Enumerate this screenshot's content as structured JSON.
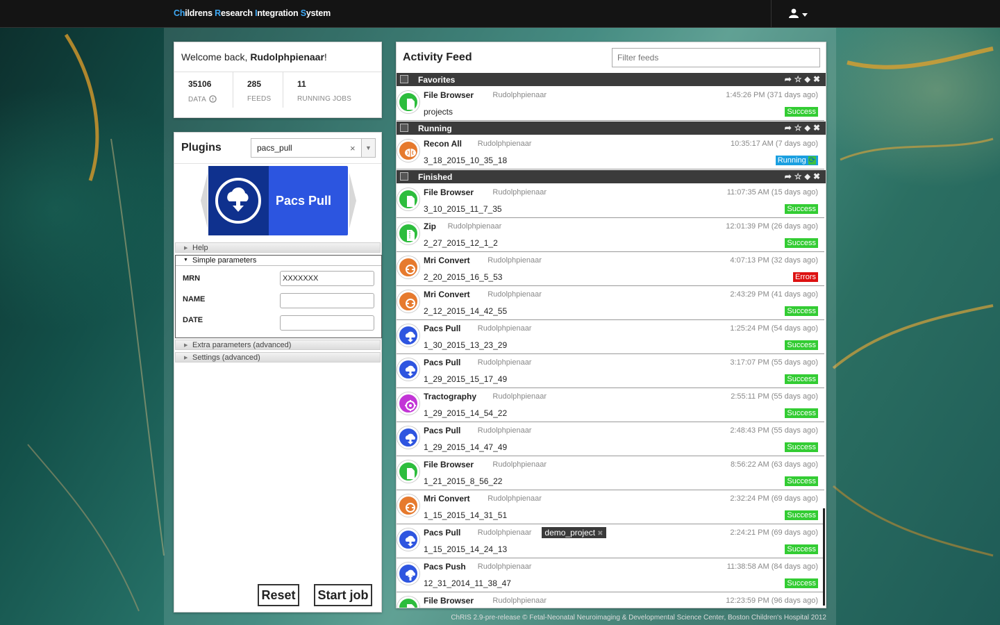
{
  "navbar": {
    "brand_parts": [
      "Ch",
      "ildrens ",
      "R",
      "esearch ",
      "I",
      "ntegration ",
      "S",
      "ystem"
    ]
  },
  "welcome": {
    "prefix": "Welcome back, ",
    "user": "Rudolphpienaar",
    "suffix": "!",
    "stats": [
      {
        "num": "35106",
        "label": "DATA"
      },
      {
        "num": "285",
        "label": "FEEDS"
      },
      {
        "num": "11",
        "label": "RUNNING JOBS"
      }
    ]
  },
  "plugins": {
    "title": "Plugins",
    "select_value": "pacs_pull",
    "clear": "×",
    "tile_name": "Pacs Pull",
    "sections": {
      "help": "Help",
      "simple": "Simple parameters",
      "extra": "Extra parameters (advanced)",
      "settings": "Settings (advanced)"
    },
    "params": [
      {
        "label": "MRN",
        "value": "XXXXXXX"
      },
      {
        "label": "NAME",
        "value": ""
      },
      {
        "label": "DATE",
        "value": ""
      }
    ],
    "reset": "Reset",
    "start": "Start job"
  },
  "feed": {
    "title": "Activity Feed",
    "filter_placeholder": "Filter feeds",
    "groups": [
      {
        "label": "Favorites",
        "items": [
          {
            "plugin": "File Browser",
            "user": "Rudolphpienaar",
            "time": "1:45:26 PM (371 days ago)",
            "feed": "projects",
            "status": "Success",
            "icon": "file-icon"
          }
        ]
      },
      {
        "label": "Running",
        "items": [
          {
            "plugin": "Recon All",
            "user": "Rudolphpienaar",
            "time": "10:35:17 AM (7 days ago)",
            "feed": "3_18_2015_10_35_18",
            "status": "Running",
            "icon": "brain-icon"
          }
        ]
      },
      {
        "label": "Finished",
        "items": [
          {
            "plugin": "File Browser",
            "user": "Rudolphpienaar",
            "time": "11:07:35 AM (15 days ago)",
            "feed": "3_10_2015_11_7_35",
            "status": "Success",
            "icon": "file-icon"
          },
          {
            "plugin": "Zip",
            "user": "Rudolphpienaar",
            "time": "12:01:39 PM (26 days ago)",
            "feed": "2_27_2015_12_1_2",
            "status": "Success",
            "icon": "zip-icon"
          },
          {
            "plugin": "Mri Convert",
            "user": "Rudolphpienaar",
            "time": "4:07:13 PM (32 days ago)",
            "feed": "2_20_2015_16_5_53",
            "status": "Errors",
            "icon": "convert-icon"
          },
          {
            "plugin": "Mri Convert",
            "user": "Rudolphpienaar",
            "time": "2:43:29 PM (41 days ago)",
            "feed": "2_12_2015_14_42_55",
            "status": "Success",
            "icon": "convert-icon"
          },
          {
            "plugin": "Pacs Pull",
            "user": "Rudolphpienaar",
            "time": "1:25:24 PM (54 days ago)",
            "feed": "1_30_2015_13_23_29",
            "status": "Success",
            "icon": "cloud-download-icon"
          },
          {
            "plugin": "Pacs Pull",
            "user": "Rudolphpienaar",
            "time": "3:17:07 PM (55 days ago)",
            "feed": "1_29_2015_15_17_49",
            "status": "Success",
            "icon": "cloud-download-icon"
          },
          {
            "plugin": "Tractography",
            "user": "Rudolphpienaar",
            "time": "2:55:11 PM (55 days ago)",
            "feed": "1_29_2015_14_54_22",
            "status": "Success",
            "icon": "tractography-icon"
          },
          {
            "plugin": "Pacs Pull",
            "user": "Rudolphpienaar",
            "time": "2:48:43 PM (55 days ago)",
            "feed": "1_29_2015_14_47_49",
            "status": "Success",
            "icon": "cloud-download-icon"
          },
          {
            "plugin": "File Browser",
            "user": "Rudolphpienaar",
            "time": "8:56:22 AM (63 days ago)",
            "feed": "1_21_2015_8_56_22",
            "status": "Success",
            "icon": "file-icon"
          },
          {
            "plugin": "Mri Convert",
            "user": "Rudolphpienaar",
            "time": "2:32:24 PM (69 days ago)",
            "feed": "1_15_2015_14_31_51",
            "status": "Success",
            "icon": "convert-icon"
          },
          {
            "plugin": "Pacs Pull",
            "user": "Rudolphpienaar",
            "tag": "demo_project",
            "time": "2:24:21 PM (69 days ago)",
            "feed": "1_15_2015_14_24_13",
            "status": "Success",
            "icon": "cloud-download-icon"
          },
          {
            "plugin": "Pacs Push",
            "user": "Rudolphpienaar",
            "time": "11:38:58 AM (84 days ago)",
            "feed": "12_31_2014_11_38_47",
            "status": "Success",
            "icon": "cloud-upload-icon"
          },
          {
            "plugin": "File Browser",
            "user": "Rudolphpienaar",
            "time": "12:23:59 PM (96 days ago)",
            "feed": "",
            "status": "",
            "icon": "file-icon"
          }
        ]
      }
    ]
  },
  "footer": "ChRIS 2.9-pre-release © Fetal-Neonatal Neuroimaging & Developmental Science Center, Boston Children's Hospital 2012",
  "colors": {
    "success": "#33cc33",
    "running": "#1a9fe0",
    "errors": "#dd1111",
    "file": "#2dbd3d",
    "convert": "#e67a2e",
    "pacs": "#2e55e0",
    "tract": "#c235d6"
  }
}
